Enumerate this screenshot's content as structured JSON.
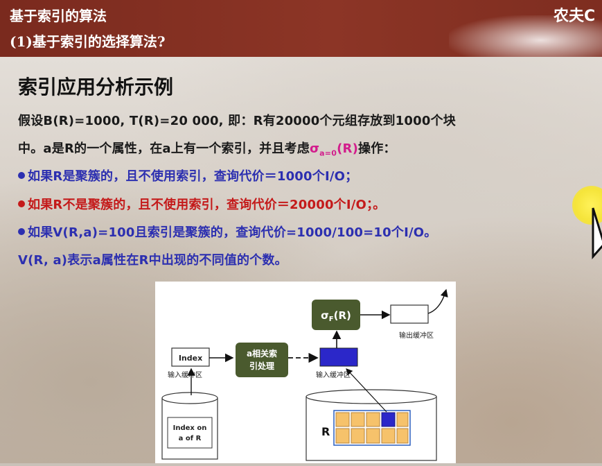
{
  "header": {
    "title": "基于索引的算法",
    "subtitle": "(1)基于索引的选择算法?",
    "brand": "农夫C"
  },
  "slide": {
    "title": "索引应用分析示例",
    "line1": "假设B(R)=1000, T(R)=20 000, 即：R有20000个元组存放到1000个块",
    "line2_a": "中。a是R的一个属性，在a上有一个索引，并且考虑",
    "line2_sigma": "σ",
    "line2_sub": "a=0",
    "line2_sigma_tail": "(R)",
    "line2_b": "操作：",
    "bullet1": "如果R是聚簇的，且不使用索引，查询代价＝1000个I/O；",
    "bullet2": "如果R不是聚簇的，且不使用索引，查询代价＝20000个I/O；。",
    "bullet3": "如果V(R,a)=100且索引是聚簇的，查询代价=1000/100=10个I/O。",
    "line6": "V(R, a)表示a属性在R中出现的不同值的个数。"
  },
  "diagram": {
    "sigma_box": "σ",
    "sigma_sub": "F",
    "sigma_tail": "(R)",
    "output_buffer_label": "输出缓冲区",
    "index_box": "Index",
    "index_buffer_label": "输入缓冲区",
    "process_box_line1": "a相关索",
    "process_box_line2": "引处理",
    "input_buffer_label": "输入缓冲区",
    "index_on_line1": "Index on",
    "index_on_line2": "a of R",
    "relation_label": "R"
  },
  "colors": {
    "header_bg": "#8c3526",
    "bullet_blue": "#2c2fb0",
    "bullet_red": "#c41a1a",
    "sigma_pink": "#d21d8c",
    "process_box": "#4a5a2e",
    "block_fill": "#f6c26b",
    "highlight_block": "#2b27c9"
  }
}
